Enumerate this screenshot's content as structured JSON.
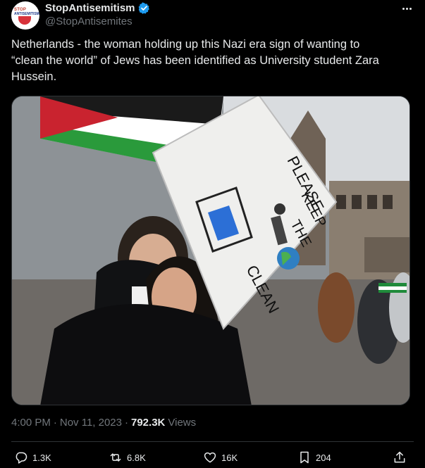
{
  "author": {
    "display_name": "StopAntisemitism",
    "handle": "@StopAntisemites",
    "avatar_text_line1": "STOP",
    "avatar_text_line2": "ANTISEMITISM"
  },
  "tweet": {
    "text": "Netherlands - the woman holding up this Nazi era sign of wanting to\n“clean the world” of Jews has been identified as University student Zara\nHussein."
  },
  "media": {
    "sign_text": [
      "PLEASE",
      "KEEP",
      "THE",
      "CLEAN"
    ]
  },
  "meta": {
    "time": "4:00 PM",
    "dot1": "·",
    "date": "Nov 11, 2023",
    "dot2": "·",
    "views": "792.3K",
    "views_label": "Views"
  },
  "actions": {
    "replies": "1.3K",
    "reposts": "6.8K",
    "likes": "16K",
    "bookmarks": "204"
  },
  "colors": {
    "background": "#000000",
    "text": "#e7e9ea",
    "muted": "#71767b",
    "border": "#2f3336",
    "verified": "#1d9bf0",
    "link": "#1d9bf0"
  }
}
